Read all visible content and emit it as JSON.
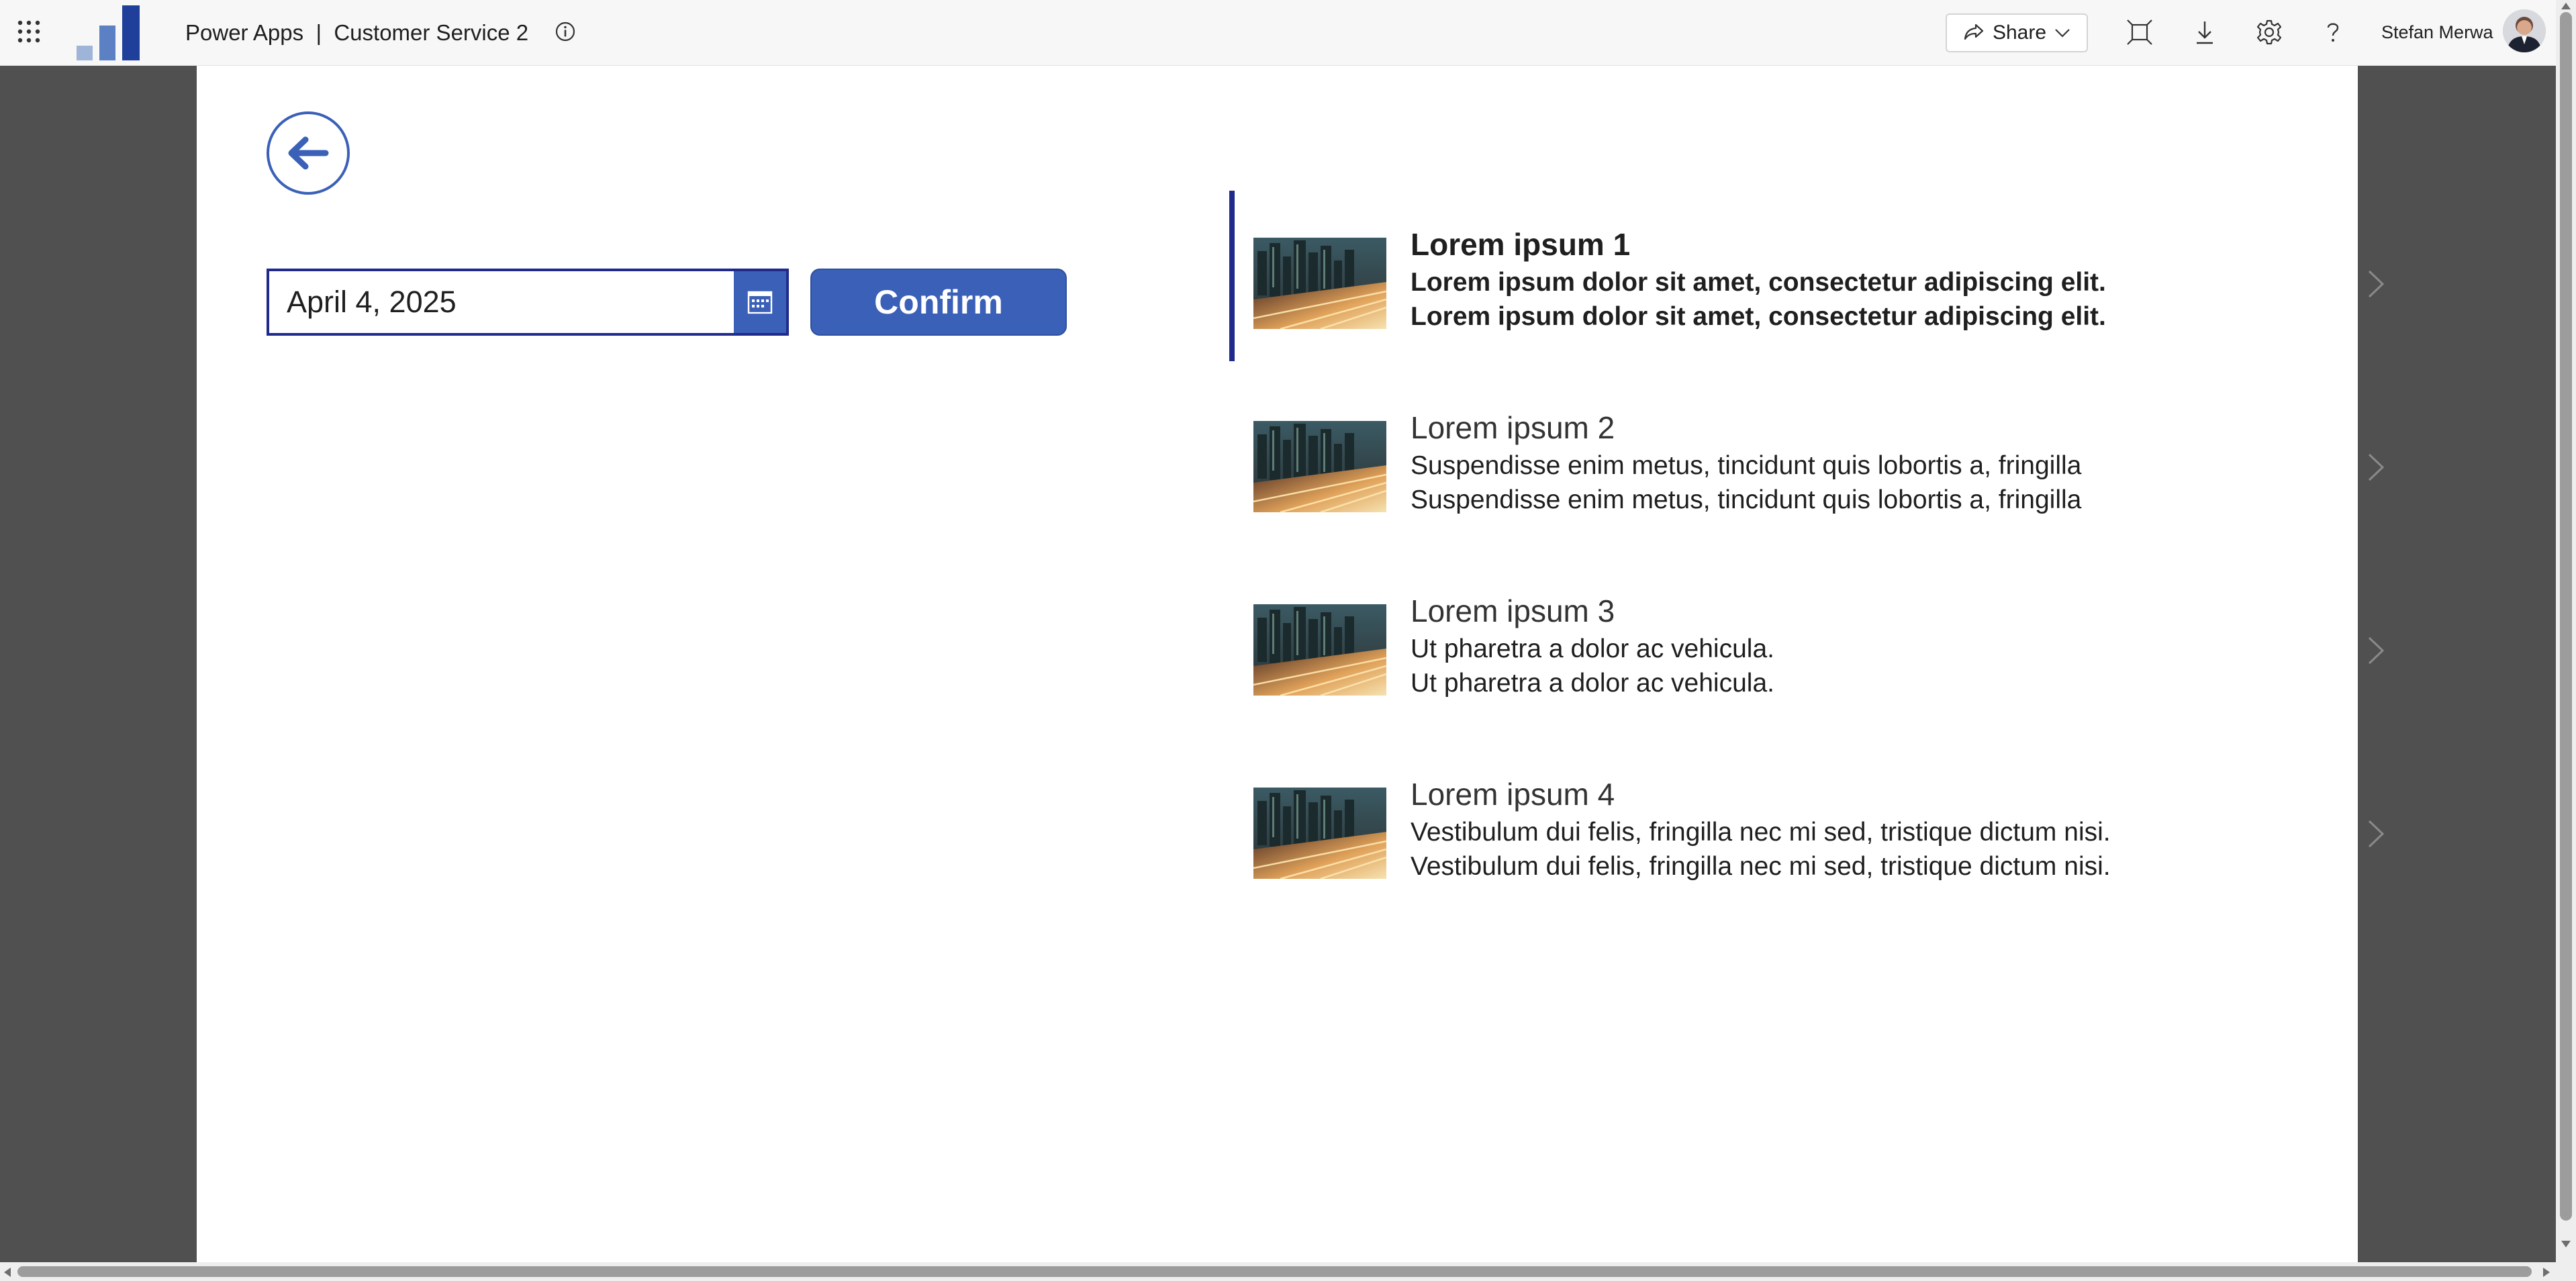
{
  "header": {
    "app_title": "Power Apps  |  Customer Service 2",
    "share_label": "Share",
    "user_name": "Stefan Merwa"
  },
  "icons": {
    "waffle": "waffle-icon",
    "info": "info-icon",
    "share": "share-icon",
    "fit_to_window": "fit-window-icon",
    "download": "download-icon",
    "settings": "gear-icon",
    "help": "help-icon",
    "back": "arrow-left-icon",
    "calendar": "calendar-icon",
    "chevron": "chevron-right-icon"
  },
  "colors": {
    "accent": "#3b60b8",
    "selection_bar": "#1f2a8c",
    "canvas_background": "#ffffff",
    "outer_background": "#505050"
  },
  "form": {
    "date_value": "April 4, 2025",
    "confirm_label": "Confirm"
  },
  "gallery": {
    "items": [
      {
        "title": "Lorem ipsum 1",
        "line1": "Lorem ipsum dolor sit amet, consectetur adipiscing elit.",
        "line2": "Lorem ipsum dolor sit amet, consectetur adipiscing elit.",
        "selected": true
      },
      {
        "title": "Lorem ipsum 2",
        "line1": "Suspendisse enim metus, tincidunt quis lobortis a, fringilla",
        "line2": "Suspendisse enim metus, tincidunt quis lobortis a, fringilla",
        "selected": false
      },
      {
        "title": "Lorem ipsum 3",
        "line1": "Ut pharetra a dolor ac vehicula.",
        "line2": "Ut pharetra a dolor ac vehicula.",
        "selected": false
      },
      {
        "title": "Lorem ipsum 4",
        "line1": "Vestibulum dui felis, fringilla nec mi sed, tristique dictum nisi.",
        "line2": "Vestibulum dui felis, fringilla nec mi sed, tristique dictum nisi.",
        "selected": false
      }
    ]
  }
}
